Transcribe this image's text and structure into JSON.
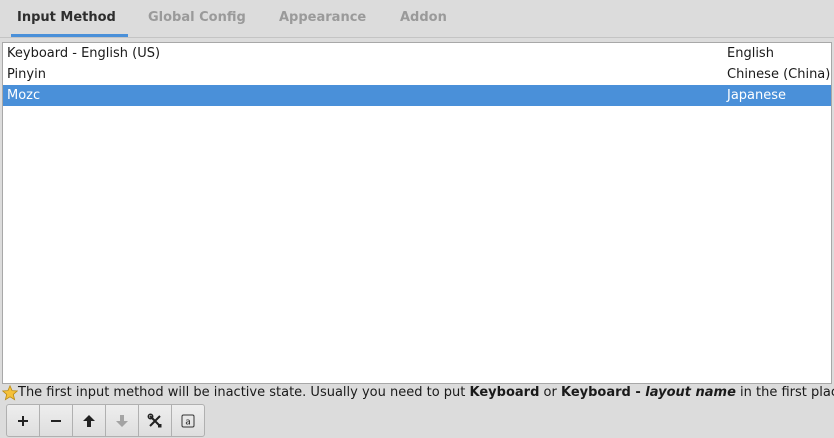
{
  "tabs": [
    {
      "label": "Input Method",
      "active": true
    },
    {
      "label": "Global Config",
      "active": false
    },
    {
      "label": "Appearance",
      "active": false
    },
    {
      "label": "Addon",
      "active": false
    }
  ],
  "input_methods": [
    {
      "name": "Keyboard - English (US)",
      "language": "English",
      "selected": false
    },
    {
      "name": "Pinyin",
      "language": "Chinese (China)",
      "selected": false
    },
    {
      "name": "Mozc",
      "language": "Japanese",
      "selected": true
    }
  ],
  "hint": {
    "icon": "star-icon",
    "part1": "The first input method will be inactive state. Usually you need to put ",
    "keyword1": "Keyboard",
    "part2": " or ",
    "keyword2": "Keyboard - ",
    "keyword2_italic": "layout name",
    "part3": " in the first place."
  },
  "toolbar": {
    "buttons": [
      {
        "icon": "add-icon",
        "enabled": true
      },
      {
        "icon": "remove-icon",
        "enabled": true
      },
      {
        "icon": "move-up-icon",
        "enabled": true
      },
      {
        "icon": "move-down-icon",
        "enabled": false
      },
      {
        "icon": "configure-icon",
        "enabled": true
      },
      {
        "icon": "keyboard-layout-icon",
        "enabled": true
      }
    ]
  },
  "colors": {
    "accent": "#4a90d9",
    "window_bg": "#dcdcdc",
    "list_bg": "#ffffff",
    "star": "#f5c13a"
  }
}
